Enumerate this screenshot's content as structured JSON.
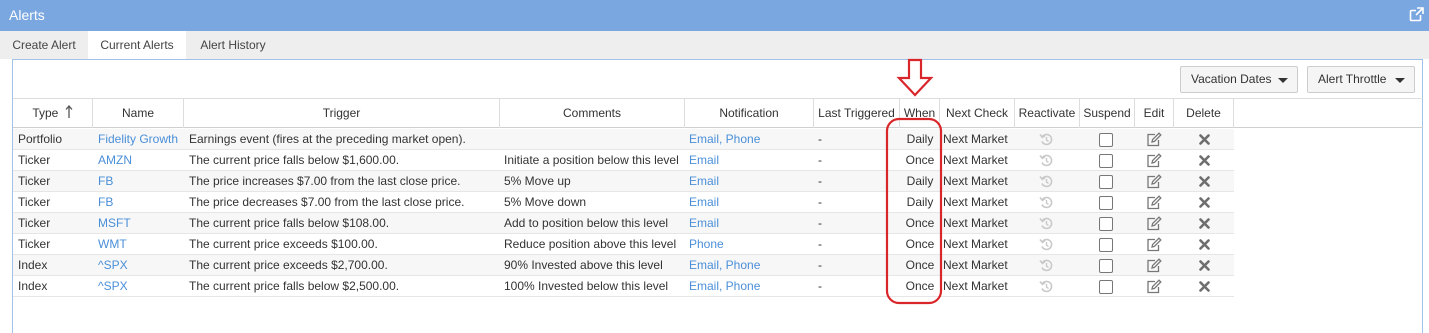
{
  "window": {
    "title": "Alerts",
    "popout_icon": "external-link-icon",
    "bar_color": "#7aa7e0"
  },
  "tabs": [
    {
      "label": "Create Alert",
      "active": false
    },
    {
      "label": "Current Alerts",
      "active": true
    },
    {
      "label": "Alert History",
      "active": false
    }
  ],
  "toolbar": {
    "vacation_label": "Vacation Dates",
    "throttle_label": "Alert Throttle"
  },
  "columns": {
    "type": "Type",
    "type_sort_icon": "sort-up-arrow-icon",
    "name": "Name",
    "trigger": "Trigger",
    "comments": "Comments",
    "notification": "Notification",
    "last_triggered": "Last Triggered",
    "when": "When",
    "next_check": "Next Check",
    "reactivate": "Reactivate",
    "suspend": "Suspend",
    "edit": "Edit",
    "delete": "Delete"
  },
  "rows": [
    {
      "type": "Portfolio",
      "name": "Fidelity Growth",
      "trigger": "Earnings event (fires at the preceding market open).",
      "comments": "",
      "notification": "Email, Phone",
      "last_triggered": "-",
      "when": "Daily",
      "next_check": "Next Market",
      "suspended": false
    },
    {
      "type": "Ticker",
      "name": "AMZN",
      "trigger": "The current price falls below $1,600.00.",
      "comments": "Initiate a position below this level",
      "notification": "Email",
      "last_triggered": "-",
      "when": "Once",
      "next_check": "Next Market",
      "suspended": false
    },
    {
      "type": "Ticker",
      "name": "FB",
      "trigger": "The price increases $7.00 from the last close price.",
      "comments": "5% Move up",
      "notification": "Email",
      "last_triggered": "-",
      "when": "Daily",
      "next_check": "Next Market",
      "suspended": false
    },
    {
      "type": "Ticker",
      "name": "FB",
      "trigger": "The price decreases $7.00 from the last close price.",
      "comments": "5% Move down",
      "notification": "Email",
      "last_triggered": "-",
      "when": "Daily",
      "next_check": "Next Market",
      "suspended": false
    },
    {
      "type": "Ticker",
      "name": "MSFT",
      "trigger": "The current price falls below $108.00.",
      "comments": "Add to position below this level",
      "notification": "Email",
      "last_triggered": "-",
      "when": "Once",
      "next_check": "Next Market",
      "suspended": false
    },
    {
      "type": "Ticker",
      "name": "WMT",
      "trigger": "The current price exceeds $100.00.",
      "comments": "Reduce position above this level",
      "notification": "Phone",
      "last_triggered": "-",
      "when": "Once",
      "next_check": "Next Market",
      "suspended": false
    },
    {
      "type": "Index",
      "name": "^SPX",
      "trigger": "The current price exceeds $2,700.00.",
      "comments": "90% Invested above this level",
      "notification": "Email, Phone",
      "last_triggered": "-",
      "when": "Once",
      "next_check": "Next Market",
      "suspended": false
    },
    {
      "type": "Index",
      "name": "^SPX",
      "trigger": "The current price falls below $2,500.00.",
      "comments": "100% Invested below this level",
      "notification": "Email, Phone",
      "last_triggered": "-",
      "when": "Once",
      "next_check": "Next Market",
      "suspended": false
    }
  ],
  "row_icons": {
    "reactivate": "reactivate-icon",
    "edit": "edit-icon",
    "delete": "delete-icon"
  },
  "annotation": {
    "color": "#d9262b",
    "arrow_icon": "down-arrow-annotation",
    "box": "highlight-box-when-column"
  },
  "colors": {
    "link": "#4a8fd8",
    "panel_border": "#9ec2ea",
    "tab_bar": "#eeeeee"
  }
}
